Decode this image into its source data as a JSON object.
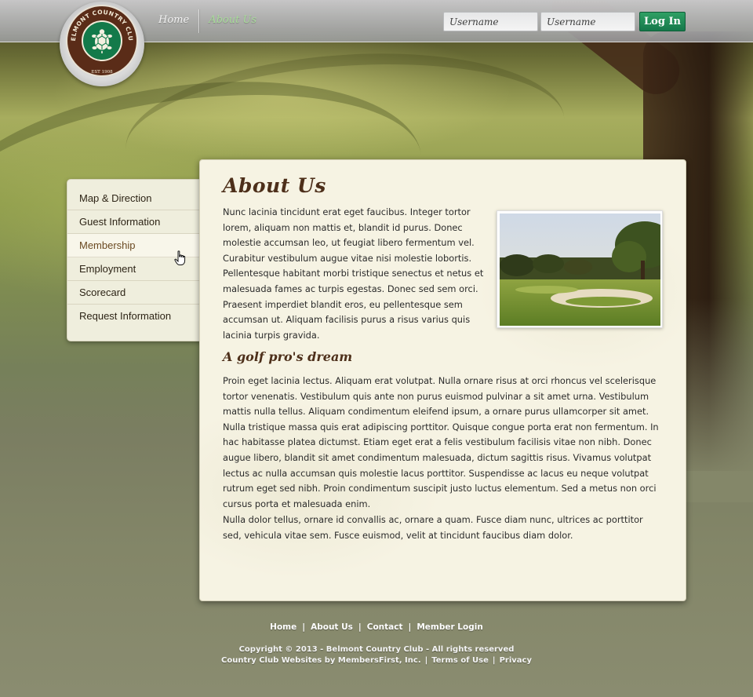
{
  "logo": {
    "club_name": "BELMONT COUNTRY CLUB",
    "est": "EST 1908"
  },
  "nav": {
    "items": [
      {
        "label": "Home",
        "active": false
      },
      {
        "label": "About Us",
        "active": true
      }
    ]
  },
  "login": {
    "username_placeholder": "Username",
    "password_placeholder": "Username",
    "button_label": "Log In"
  },
  "sidemenu": {
    "items": [
      {
        "label": "Map & Direction"
      },
      {
        "label": "Guest Information"
      },
      {
        "label": "Membership",
        "hover": true
      },
      {
        "label": "Employment"
      },
      {
        "label": "Scorecard"
      },
      {
        "label": "Request Information"
      }
    ]
  },
  "content": {
    "title": "About Us",
    "intro": "Nunc lacinia tincidunt erat eget faucibus. Integer tortor lorem, aliquam non mattis et, blandit id purus. Donec molestie accumsan leo, ut feugiat libero fermentum vel. Curabitur vestibulum augue vitae nisi molestie lobortis. Pellentesque habitant morbi tristique senectus et netus et malesuada fames ac turpis egestas. Donec sed sem orci. Praesent imperdiet blandit eros, eu pellentesque sem accumsan ut. Aliquam facilisis purus a risus varius quis lacinia turpis gravida.",
    "subheading": "A golf pro's dream",
    "paragraph1": "Proin eget lacinia lectus. Aliquam erat volutpat. Nulla ornare risus at orci rhoncus vel scelerisque tortor venenatis. Vestibulum quis ante non purus euismod pulvinar a sit amet urna. Vestibulum mattis nulla tellus. Aliquam condimentum eleifend ipsum, a ornare purus ullamcorper sit amet. Nulla tristique massa quis erat adipiscing porttitor. Quisque congue porta erat non fermentum. In hac habitasse platea dictumst. Etiam eget erat a felis vestibulum facilisis vitae non nibh. Donec augue libero, blandit sit amet condimentum malesuada, dictum sagittis risus. Vivamus volutpat lectus ac nulla accumsan quis molestie lacus porttitor. Suspendisse ac lacus eu neque volutpat rutrum eget sed nibh. Proin condimentum suscipit justo luctus elementum. Sed a metus non orci cursus porta et malesuada enim.",
    "paragraph2": "Nulla dolor tellus, ornare id convallis ac, ornare a quam. Fusce diam nunc, ultrices ac porttitor sed, vehicula vitae sem. Fusce euismod, velit at tincidunt faucibus diam dolor."
  },
  "footer": {
    "links": [
      "Home",
      "About Us",
      "Contact",
      "Member Login"
    ],
    "copyright": "Copyright © 2013  -  Belmont Country Club  -  All rights reserved",
    "credit": "Country Club Websites by MembersFirst, Inc.",
    "terms": "Terms of Use",
    "privacy": "Privacy"
  },
  "colors": {
    "brand_green": "#137a4a",
    "brand_brown": "#5a2c18",
    "nav_active": "#a8dd9a",
    "heading_brown": "#4d2f1a"
  },
  "icons": {
    "logo_emblem": "turtle-icon",
    "cursor": "hand-cursor-icon"
  }
}
